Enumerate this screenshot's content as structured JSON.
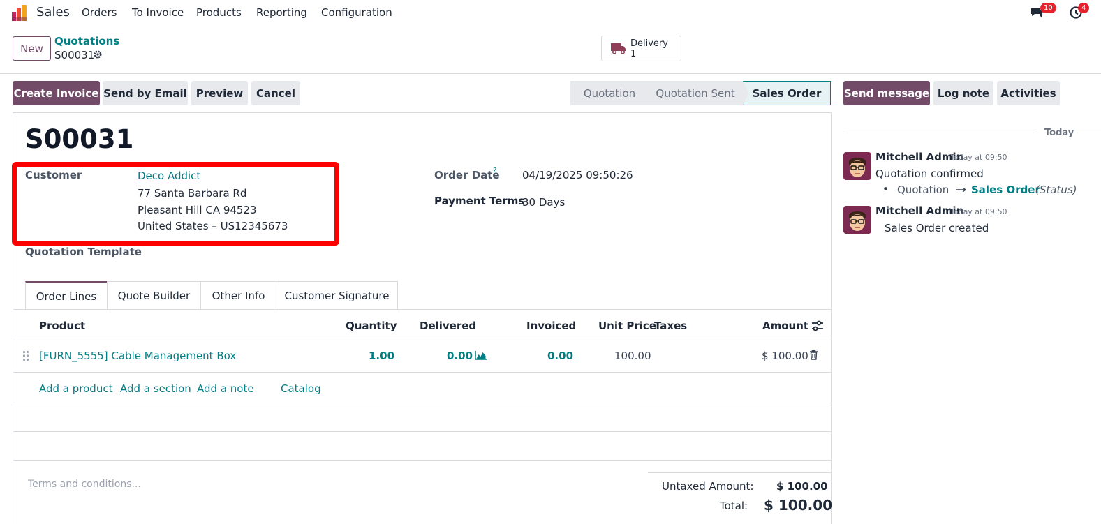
{
  "navbar": {
    "app_name": "Sales",
    "menu": [
      "Orders",
      "To Invoice",
      "Products",
      "Reporting",
      "Configuration"
    ],
    "messages_count": "10",
    "activities_count": "4"
  },
  "control_panel": {
    "new_label": "New",
    "breadcrumb_parent": "Quotations",
    "breadcrumb_current": "S00031",
    "delivery_label": "Delivery",
    "delivery_count": "1"
  },
  "actions": {
    "create_invoice": "Create Invoice",
    "send_by_email": "Send by Email",
    "preview": "Preview",
    "cancel": "Cancel"
  },
  "statusbar": [
    "Quotation",
    "Quotation Sent",
    "Sales Order"
  ],
  "chatter_actions": {
    "send_message": "Send message",
    "log_note": "Log note",
    "activities": "Activities"
  },
  "form": {
    "name": "S00031",
    "customer_label": "Customer",
    "customer_name": "Deco Addict",
    "address_line1": "77 Santa Barbara Rd",
    "address_line2": "Pleasant Hill CA 94523",
    "address_line3": "United States – US12345673",
    "quotation_template_label": "Quotation Template",
    "order_date_label": "Order Date",
    "order_date_help": "?",
    "order_date": "04/19/2025 09:50:26",
    "payment_terms_label": "Payment Terms",
    "payment_terms": "30 Days"
  },
  "tabs": [
    "Order Lines",
    "Quote Builder",
    "Other Info",
    "Customer Signature"
  ],
  "table": {
    "headers": {
      "product": "Product",
      "quantity": "Quantity",
      "delivered": "Delivered",
      "invoiced": "Invoiced",
      "unit_price": "Unit Price",
      "taxes": "Taxes",
      "amount": "Amount"
    },
    "rows": [
      {
        "product": "[FURN_5555] Cable Management Box",
        "quantity": "1.00",
        "delivered": "0.00",
        "invoiced": "0.00",
        "unit_price": "100.00",
        "taxes": "",
        "amount": "$ 100.00"
      }
    ],
    "add_product": "Add a product",
    "add_section": "Add a section",
    "add_note": "Add a note",
    "catalog": "Catalog"
  },
  "footer": {
    "terms_placeholder": "Terms and conditions...",
    "untaxed_label": "Untaxed Amount:",
    "untaxed_value": "$ 100.00",
    "total_label": "Total:",
    "total_value": "$ 100.00"
  },
  "chatter": {
    "date_separator": "Today",
    "messages": [
      {
        "author": "Mitchell Admin",
        "time": "Today at 09:50",
        "body": "Quotation confirmed",
        "tracking_old": "Quotation",
        "tracking_new": "Sales Order",
        "tracking_field": "(Status)"
      },
      {
        "author": "Mitchell Admin",
        "time": "Today at 09:50",
        "body": "Sales Order created"
      }
    ]
  },
  "colors": {
    "brand": "#714b67",
    "link": "#017e84",
    "highlight": "#ff0000",
    "badge": "#e4232f"
  }
}
